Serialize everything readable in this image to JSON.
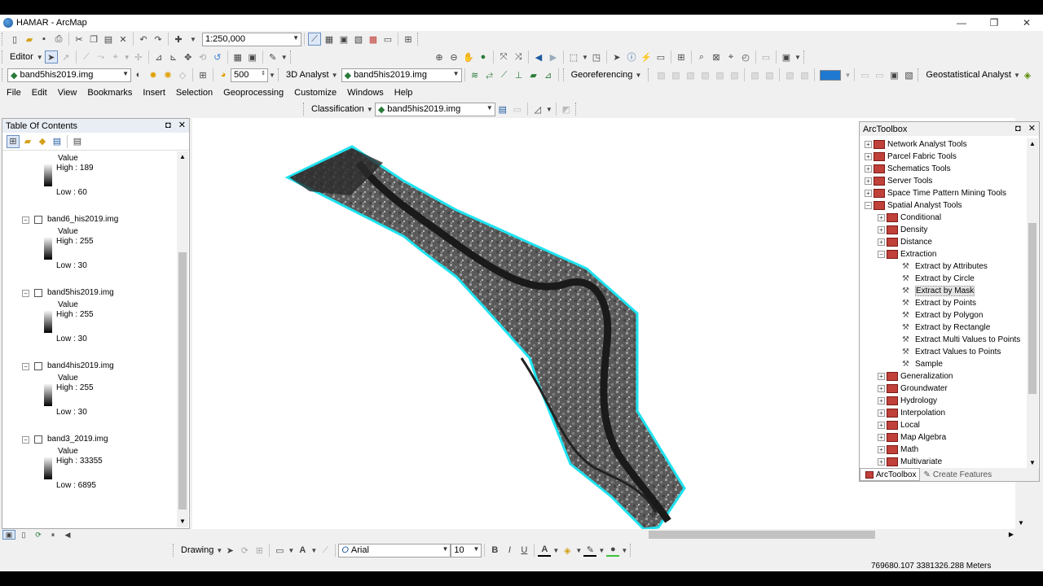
{
  "window": {
    "title": "HAMAR - ArcMap",
    "controls": [
      "—",
      "❐",
      "✕"
    ]
  },
  "toolbar1": {
    "scale": "1:250,000"
  },
  "toolbar2": {
    "editor_label": "Editor"
  },
  "toolbar3": {
    "layer_combo": "band5his2019.img",
    "contrast_value": "500",
    "analyst_3d": "3D Analyst",
    "analyst_layer": "band5his2019.img",
    "georeferencing": "Georeferencing",
    "geostat": "Geostatistical Analyst"
  },
  "menu": [
    "File",
    "Edit",
    "View",
    "Bookmarks",
    "Insert",
    "Selection",
    "Geoprocessing",
    "Customize",
    "Windows",
    "Help"
  ],
  "classification": {
    "label": "Classification",
    "layer": "band5his2019.img"
  },
  "toc": {
    "title": "Table Of Contents",
    "layers": [
      {
        "name": "",
        "value_label": "Value",
        "high": "High : 189",
        "low": "Low : 60"
      },
      {
        "name": "band6_his2019.img",
        "value_label": "Value",
        "high": "High : 255",
        "low": "Low : 30"
      },
      {
        "name": "band5his2019.img",
        "value_label": "Value",
        "high": "High : 255",
        "low": "Low : 30"
      },
      {
        "name": "band4his2019.img",
        "value_label": "Value",
        "high": "High : 255",
        "low": "Low : 30"
      },
      {
        "name": "band3_2019.img",
        "value_label": "Value",
        "high": "High : 33355",
        "low": "Low : 6895"
      }
    ]
  },
  "arctoolbox": {
    "title": "ArcToolbox",
    "items": [
      {
        "label": "Network Analyst Tools",
        "level": 0,
        "kind": "box",
        "exp": "+"
      },
      {
        "label": "Parcel Fabric Tools",
        "level": 0,
        "kind": "box",
        "exp": "+"
      },
      {
        "label": "Schematics Tools",
        "level": 0,
        "kind": "box",
        "exp": "+"
      },
      {
        "label": "Server Tools",
        "level": 0,
        "kind": "box",
        "exp": "+"
      },
      {
        "label": "Space Time Pattern Mining Tools",
        "level": 0,
        "kind": "box",
        "exp": "+"
      },
      {
        "label": "Spatial Analyst Tools",
        "level": 0,
        "kind": "box",
        "exp": "−"
      },
      {
        "label": "Conditional",
        "level": 1,
        "kind": "box",
        "exp": "+"
      },
      {
        "label": "Density",
        "level": 1,
        "kind": "box",
        "exp": "+"
      },
      {
        "label": "Distance",
        "level": 1,
        "kind": "box",
        "exp": "+"
      },
      {
        "label": "Extraction",
        "level": 1,
        "kind": "box",
        "exp": "−"
      },
      {
        "label": "Extract by Attributes",
        "level": 2,
        "kind": "tool",
        "exp": ""
      },
      {
        "label": "Extract by Circle",
        "level": 2,
        "kind": "tool",
        "exp": ""
      },
      {
        "label": "Extract by Mask",
        "level": 2,
        "kind": "tool",
        "exp": ""
      },
      {
        "label": "Extract by Points",
        "level": 2,
        "kind": "tool",
        "exp": ""
      },
      {
        "label": "Extract by Polygon",
        "level": 2,
        "kind": "tool",
        "exp": ""
      },
      {
        "label": "Extract by Rectangle",
        "level": 2,
        "kind": "tool",
        "exp": ""
      },
      {
        "label": "Extract Multi Values to Points",
        "level": 2,
        "kind": "tool",
        "exp": ""
      },
      {
        "label": "Extract Values to Points",
        "level": 2,
        "kind": "tool",
        "exp": ""
      },
      {
        "label": "Sample",
        "level": 2,
        "kind": "tool",
        "exp": ""
      },
      {
        "label": "Generalization",
        "level": 1,
        "kind": "box",
        "exp": "+"
      },
      {
        "label": "Groundwater",
        "level": 1,
        "kind": "box",
        "exp": "+"
      },
      {
        "label": "Hydrology",
        "level": 1,
        "kind": "box",
        "exp": "+"
      },
      {
        "label": "Interpolation",
        "level": 1,
        "kind": "box",
        "exp": "+"
      },
      {
        "label": "Local",
        "level": 1,
        "kind": "box",
        "exp": "+"
      },
      {
        "label": "Map Algebra",
        "level": 1,
        "kind": "box",
        "exp": "+"
      },
      {
        "label": "Math",
        "level": 1,
        "kind": "box",
        "exp": "+"
      },
      {
        "label": "Multivariate",
        "level": 1,
        "kind": "box",
        "exp": "+"
      }
    ],
    "tab_active": "ArcToolbox",
    "tab_other": "Create Features"
  },
  "drawing": {
    "label": "Drawing",
    "font": "Arial",
    "size": "10"
  },
  "status": {
    "coords": "769680.107  3381326.288 Meters"
  },
  "colors": {
    "outline": "#1ee3f0",
    "toolbox_red": "#c0403a"
  }
}
